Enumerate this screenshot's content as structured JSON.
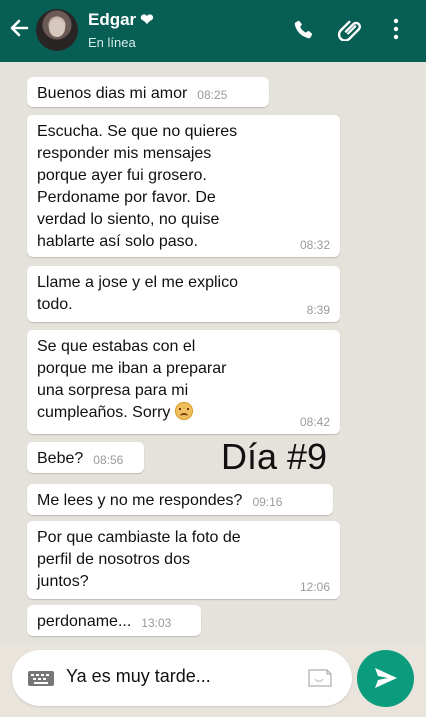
{
  "header": {
    "contact_name": "Edgar",
    "heart": "❤",
    "status": "En línea"
  },
  "icons": {
    "back": "arrow-left-icon",
    "avatar": "avatar",
    "phone": "phone-icon",
    "attach": "paperclip-icon",
    "menu": "more-vertical-icon",
    "keyboard": "keyboard-icon",
    "sticker": "sticker-icon",
    "send": "send-icon"
  },
  "messages": [
    {
      "text": "Buenos dias mi amor",
      "time": "08:25"
    },
    {
      "text": "Escucha. Se que no quieres\nresponder mis mensajes\nporque ayer fui grosero.\nPerdoname por favor. De\nverdad lo siento, no quise\nhablarte así solo paso.",
      "time": "08:32"
    },
    {
      "text": "Llame a jose y el me explico\ntodo.",
      "time": "8:39"
    },
    {
      "text": "Se que estabas con el\nporque me iban a preparar\nuna sorpresa para mi\ncumpleaños. Sorry",
      "time": "08:42",
      "emoji": "sad-face-emoji"
    },
    {
      "text": "Bebe?",
      "time": "08:56"
    },
    {
      "text": "Me lees y no me respondes?",
      "time": "09:16"
    },
    {
      "text": "Por que cambiaste la foto de\nperfil de nosotros dos\njuntos?",
      "time": "12:06"
    },
    {
      "text": "perdoname...",
      "time": "13:03"
    }
  ],
  "overlay": {
    "day_label": "Día #9"
  },
  "composer": {
    "value": "Ya es muy tarde..."
  },
  "colors": {
    "header": "#075e54",
    "background": "#e5e2db",
    "bubble": "#ffffff",
    "send": "#0b9c7d"
  }
}
